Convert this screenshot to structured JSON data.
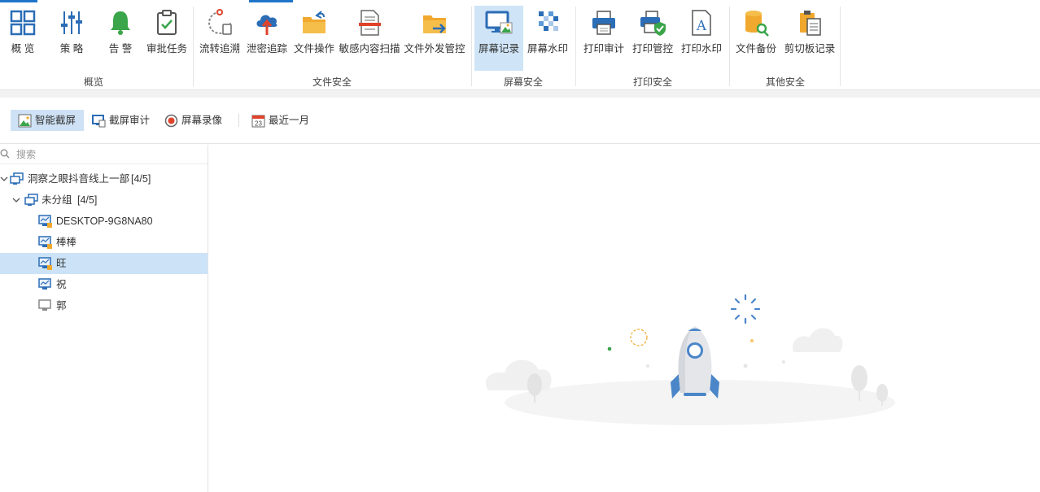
{
  "ribbon": {
    "groups": [
      {
        "label": "概览",
        "items": [
          {
            "label": "概 览"
          },
          {
            "label": "策 略"
          },
          {
            "label": "告 警"
          },
          {
            "label": "审批任务"
          }
        ]
      },
      {
        "label": "文件安全",
        "items": [
          {
            "label": "流转追溯"
          },
          {
            "label": "泄密追踪"
          },
          {
            "label": "文件操作"
          },
          {
            "label": "敏感内容扫描"
          },
          {
            "label": "文件外发管控"
          }
        ]
      },
      {
        "label": "屏幕安全",
        "items": [
          {
            "label": "屏幕记录"
          },
          {
            "label": "屏幕水印"
          }
        ]
      },
      {
        "label": "打印安全",
        "items": [
          {
            "label": "打印审计"
          },
          {
            "label": "打印管控"
          },
          {
            "label": "打印水印"
          }
        ]
      },
      {
        "label": "其他安全",
        "items": [
          {
            "label": "文件备份"
          },
          {
            "label": "剪切板记录"
          }
        ]
      }
    ],
    "active_item": "屏幕记录"
  },
  "toolbar": {
    "smart_screenshot": "智能截屏",
    "screenshot_audit": "截屏审计",
    "screen_recording": "屏幕录像",
    "date_range": "最近一月"
  },
  "search": {
    "placeholder": "搜索"
  },
  "tree": {
    "root": {
      "label": "洞察之眼抖音线上一部",
      "count": "[4/5]"
    },
    "group": {
      "label": "未分组",
      "count": "[4/5]"
    },
    "devices": [
      {
        "label": "DESKTOP-9G8NA80",
        "online": true
      },
      {
        "label": "棒棒",
        "online": true
      },
      {
        "label": "旺",
        "online": true,
        "selected": true
      },
      {
        "label": "祝",
        "online": true
      },
      {
        "label": "郭",
        "online": false
      }
    ]
  },
  "colors": {
    "accent": "#1e74c8",
    "selection": "#cce3f7",
    "icon_blue": "#2b6db6",
    "icon_orange": "#f0a92e",
    "icon_green": "#3aa54a",
    "icon_red": "#e0432b"
  }
}
